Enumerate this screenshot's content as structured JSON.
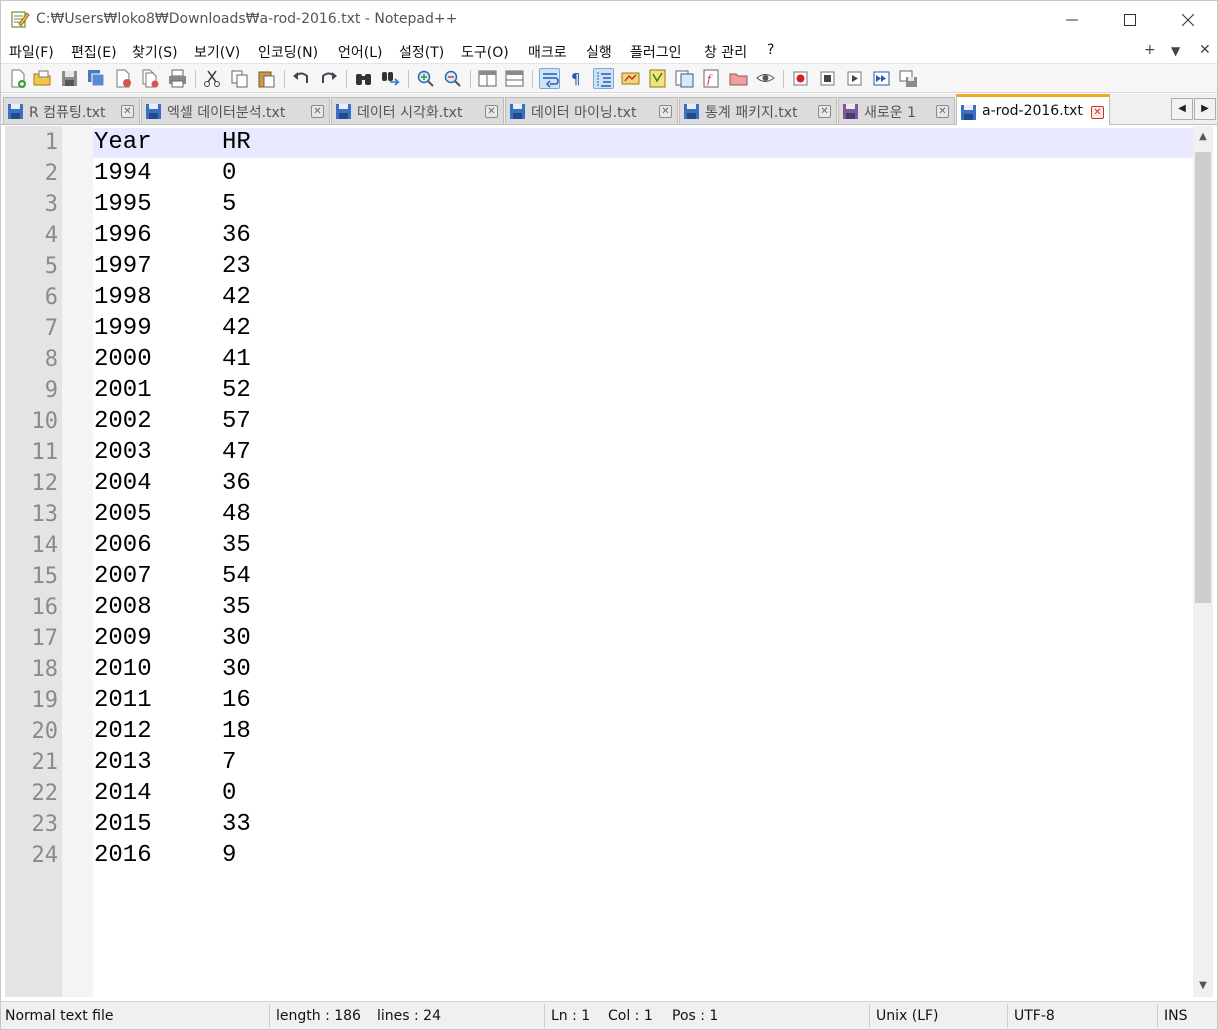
{
  "window": {
    "title": "C:₩Users₩loko8₩Downloads₩a-rod-2016.txt - Notepad++"
  },
  "menu": {
    "items": [
      "파일(F)",
      "편집(E)",
      "찾기(S)",
      "보기(V)",
      "인코딩(N)",
      "언어(L)",
      "설정(T)",
      "도구(O)",
      "매크로",
      "실행",
      "플러그인",
      "창 관리",
      "?"
    ],
    "right_plus": "+",
    "right_down": "▼",
    "right_close": "✕"
  },
  "tabs": [
    {
      "label": "R 컴퓨팅.txt",
      "active": false
    },
    {
      "label": "엑셀 데이터분석.txt",
      "active": false
    },
    {
      "label": "데이터 시각화.txt",
      "active": false
    },
    {
      "label": "데이터 마이닝.txt",
      "active": false
    },
    {
      "label": "통계 패키지.txt",
      "active": false
    },
    {
      "label": "새로운 1",
      "active": false
    },
    {
      "label": "a-rod-2016.txt",
      "active": true
    }
  ],
  "tab_close_glyph": "✕",
  "tab_nav": {
    "left": "◀",
    "right": "▶"
  },
  "editor": {
    "lines": [
      {
        "num": "1",
        "c1": "Year",
        "c2": "HR"
      },
      {
        "num": "2",
        "c1": "1994",
        "c2": "0"
      },
      {
        "num": "3",
        "c1": "1995",
        "c2": "5"
      },
      {
        "num": "4",
        "c1": "1996",
        "c2": "36"
      },
      {
        "num": "5",
        "c1": "1997",
        "c2": "23"
      },
      {
        "num": "6",
        "c1": "1998",
        "c2": "42"
      },
      {
        "num": "7",
        "c1": "1999",
        "c2": "42"
      },
      {
        "num": "8",
        "c1": "2000",
        "c2": "41"
      },
      {
        "num": "9",
        "c1": "2001",
        "c2": "52"
      },
      {
        "num": "10",
        "c1": "2002",
        "c2": "57"
      },
      {
        "num": "11",
        "c1": "2003",
        "c2": "47"
      },
      {
        "num": "12",
        "c1": "2004",
        "c2": "36"
      },
      {
        "num": "13",
        "c1": "2005",
        "c2": "48"
      },
      {
        "num": "14",
        "c1": "2006",
        "c2": "35"
      },
      {
        "num": "15",
        "c1": "2007",
        "c2": "54"
      },
      {
        "num": "16",
        "c1": "2008",
        "c2": "35"
      },
      {
        "num": "17",
        "c1": "2009",
        "c2": "30"
      },
      {
        "num": "18",
        "c1": "2010",
        "c2": "30"
      },
      {
        "num": "19",
        "c1": "2011",
        "c2": "16"
      },
      {
        "num": "20",
        "c1": "2012",
        "c2": "18"
      },
      {
        "num": "21",
        "c1": "2013",
        "c2": "7"
      },
      {
        "num": "22",
        "c1": "2014",
        "c2": "0"
      },
      {
        "num": "23",
        "c1": "2015",
        "c2": "33"
      },
      {
        "num": "24",
        "c1": "2016",
        "c2": "9"
      }
    ]
  },
  "scroll": {
    "up": "▲",
    "down": "▼"
  },
  "status": {
    "file_type": "Normal text file",
    "length": "length : 186",
    "lines": "lines : 24",
    "ln": "Ln : 1",
    "col": "Col : 1",
    "pos": "Pos : 1",
    "eol": "Unix (LF)",
    "encoding": "UTF-8",
    "mode": "INS"
  },
  "colors": {
    "active_tab_accent": "#f5a623",
    "current_line": "#e8e8ff",
    "gutter": "#e4e4e4"
  }
}
